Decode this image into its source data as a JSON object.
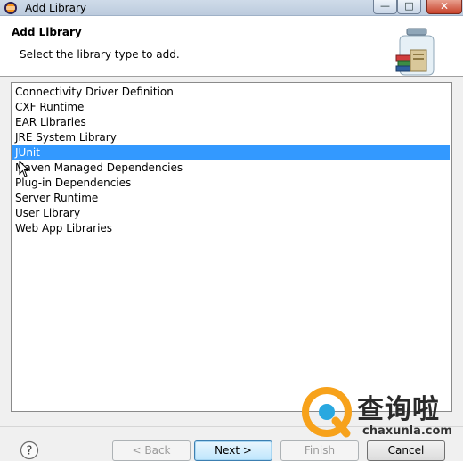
{
  "window": {
    "title": "Add Library"
  },
  "header": {
    "title": "Add Library",
    "description": "Select the library type to add."
  },
  "library_types": {
    "selected_index": 4,
    "items": [
      "Connectivity Driver Definition",
      "CXF Runtime",
      "EAR Libraries",
      "JRE System Library",
      "JUnit",
      "Maven Managed Dependencies",
      "Plug-in Dependencies",
      "Server Runtime",
      "User Library",
      "Web App Libraries"
    ]
  },
  "buttons": {
    "help": "?",
    "back": "< Back",
    "next": "Next >",
    "finish": "Finish",
    "cancel": "Cancel"
  },
  "watermark": {
    "text": "查询啦",
    "sub": "chaxunla.com"
  },
  "colors": {
    "selection": "#3399ff",
    "header_bg": "#ffffff",
    "dialog_bg": "#f0f0f0"
  }
}
